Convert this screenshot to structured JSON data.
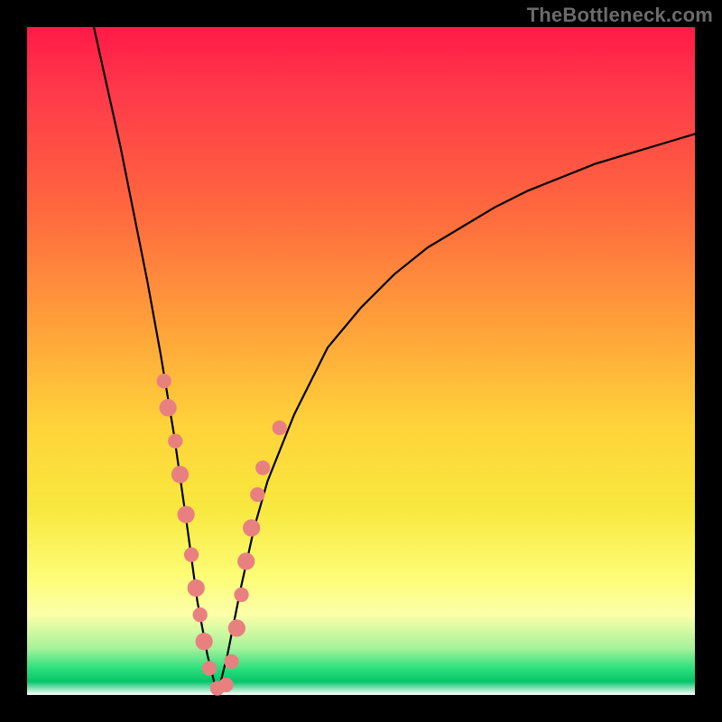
{
  "attribution": "TheBottleneck.com",
  "colors": {
    "curve_stroke": "#000000",
    "marker_fill": "#e98080",
    "marker_stroke": "#e98080"
  },
  "chart_data": {
    "type": "line",
    "title": "",
    "xlabel": "",
    "ylabel": "",
    "xlim": [
      0,
      100
    ],
    "ylim": [
      0,
      100
    ],
    "series": [
      {
        "name": "left-branch",
        "x": [
          10,
          12,
          14,
          16,
          18,
          20,
          22,
          24,
          25.5,
          27,
          28.5
        ],
        "y": [
          100,
          91,
          82,
          72,
          62,
          51,
          39,
          25,
          14,
          6,
          0
        ]
      },
      {
        "name": "right-branch",
        "x": [
          28.5,
          30,
          32,
          34,
          36,
          40,
          45,
          50,
          55,
          60,
          65,
          70,
          75,
          80,
          85,
          90,
          95,
          100
        ],
        "y": [
          0,
          6,
          16,
          25,
          32,
          42,
          52,
          58,
          63,
          67,
          70,
          73,
          75.5,
          77.5,
          79.5,
          81,
          82.5,
          84
        ]
      }
    ],
    "markers": [
      {
        "x": 20.5,
        "y": 47,
        "r": 1.1
      },
      {
        "x": 21.1,
        "y": 43,
        "r": 1.3
      },
      {
        "x": 22.2,
        "y": 38,
        "r": 1.1
      },
      {
        "x": 22.9,
        "y": 33,
        "r": 1.3
      },
      {
        "x": 23.8,
        "y": 27,
        "r": 1.3
      },
      {
        "x": 24.6,
        "y": 21,
        "r": 1.1
      },
      {
        "x": 25.3,
        "y": 16,
        "r": 1.3
      },
      {
        "x": 25.9,
        "y": 12,
        "r": 1.1
      },
      {
        "x": 26.5,
        "y": 8,
        "r": 1.3
      },
      {
        "x": 27.3,
        "y": 4,
        "r": 1.1
      },
      {
        "x": 28.5,
        "y": 1,
        "r": 1.1
      },
      {
        "x": 29.8,
        "y": 1.5,
        "r": 1.1
      },
      {
        "x": 30.6,
        "y": 5,
        "r": 1.1
      },
      {
        "x": 31.4,
        "y": 10,
        "r": 1.3
      },
      {
        "x": 32.1,
        "y": 15,
        "r": 1.1
      },
      {
        "x": 32.8,
        "y": 20,
        "r": 1.3
      },
      {
        "x": 33.6,
        "y": 25,
        "r": 1.3
      },
      {
        "x": 34.5,
        "y": 30,
        "r": 1.1
      },
      {
        "x": 35.3,
        "y": 34,
        "r": 1.1
      },
      {
        "x": 37.8,
        "y": 40,
        "r": 1.1
      }
    ]
  }
}
